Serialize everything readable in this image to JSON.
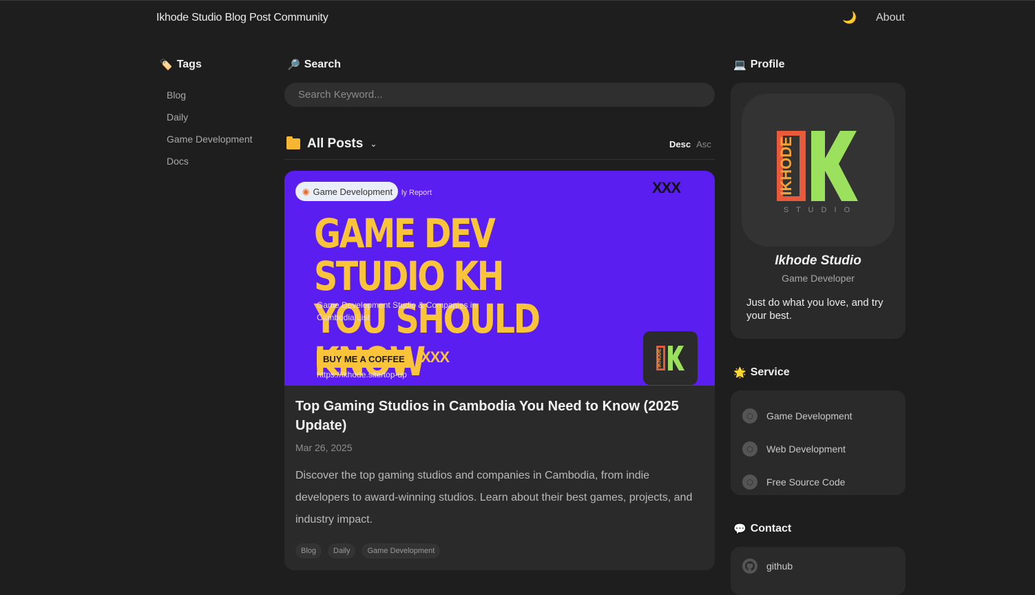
{
  "header": {
    "site_title": "Ikhode Studio Blog Post Community",
    "theme_icon": "🌙",
    "about_label": "About"
  },
  "tags": {
    "title": "Tags",
    "icon": "🏷️",
    "items": [
      "Blog",
      "Daily",
      "Game Development",
      "Docs"
    ]
  },
  "search": {
    "title": "Search",
    "icon": "🔎",
    "placeholder": "Search Keyword..."
  },
  "posts": {
    "title": "All Posts",
    "sort_desc": "Desc",
    "sort_asc": "Asc",
    "items": [
      {
        "category": "Game Development",
        "thumb_report": "ly Report",
        "thumb_xxx": "XXX",
        "thumb_headline": "GAME DEV STUDIO KH YOU SHOULD KNOW",
        "thumb_subtitle": "Game Development Studio & Companies in Cambodia List",
        "thumb_button": "BUY ME A COFFEE",
        "thumb_url": "https://ikhode.site/top-up",
        "title": "Top Gaming Studios in Cambodia You Need to Know (2025 Update)",
        "date": "Mar 26, 2025",
        "excerpt": "Discover the top gaming studios and companies in Cambodia, from indie developers to award-winning studios. Learn about their best games, projects, and industry impact.",
        "tags": [
          "Blog",
          "Daily",
          "Game Development"
        ]
      }
    ]
  },
  "profile": {
    "title": "Profile",
    "icon": "💻",
    "name": "Ikhode Studio",
    "role": "Game Developer",
    "bio": "Just do what you love, and try your best.",
    "logo_text": "IKHODE",
    "logo_letter": "K",
    "logo_sub": "S T U D I O"
  },
  "service": {
    "title": "Service",
    "icon": "🌟",
    "items": [
      "Game Development",
      "Web Development",
      "Free Source Code"
    ]
  },
  "contact": {
    "title": "Contact",
    "icon": "💬",
    "items": [
      "github"
    ]
  }
}
